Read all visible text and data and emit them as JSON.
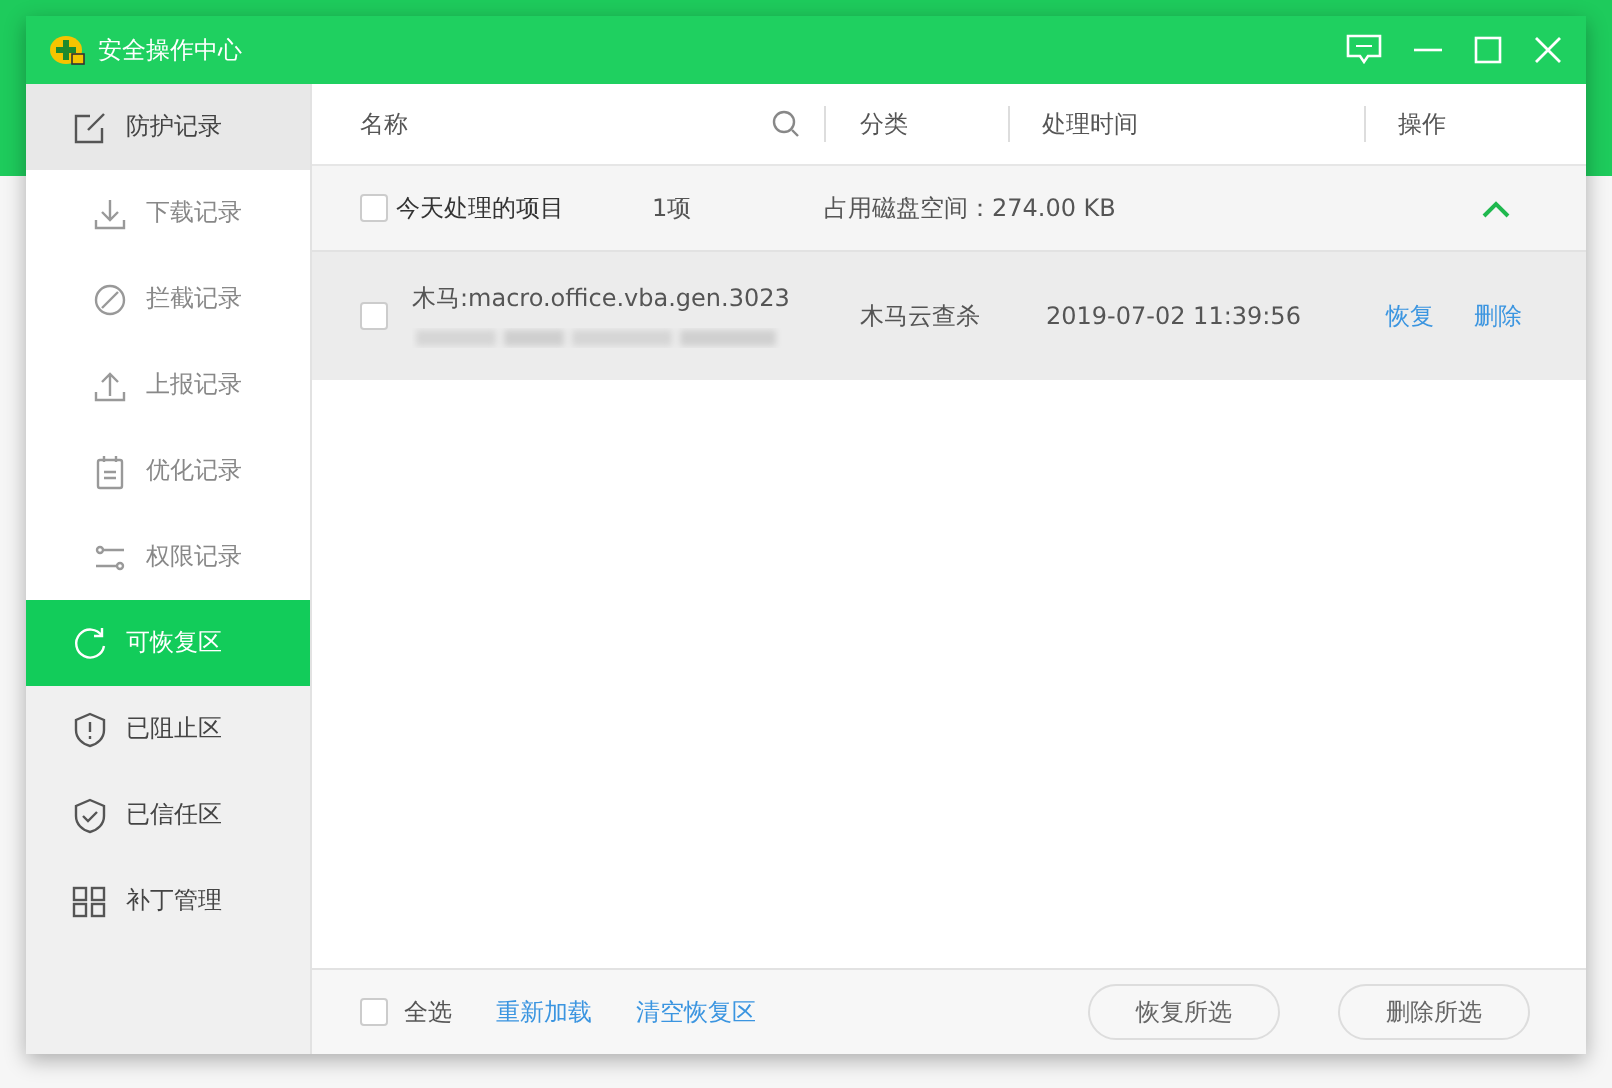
{
  "window": {
    "title": "安全操作中心"
  },
  "sidebar": {
    "items": [
      {
        "label": "防护记录",
        "selected": false,
        "expanded": true,
        "children": [
          {
            "label": "下载记录",
            "selected": false
          },
          {
            "label": "拦截记录",
            "selected": false
          },
          {
            "label": "上报记录",
            "selected": false
          },
          {
            "label": "优化记录",
            "selected": false
          },
          {
            "label": "权限记录",
            "selected": false
          }
        ]
      },
      {
        "label": "可恢复区",
        "selected": true
      },
      {
        "label": "已阻止区",
        "selected": false
      },
      {
        "label": "已信任区",
        "selected": false
      },
      {
        "label": "补丁管理",
        "selected": false
      }
    ]
  },
  "table": {
    "columns": [
      "名称",
      "分类",
      "处理时间",
      "操作"
    ],
    "groups": [
      {
        "title": "今天处理的项目",
        "count": "1项",
        "size": "占用磁盘空间：274.00 KB",
        "checked": false,
        "expanded": true,
        "rows": [
          {
            "name": "木马:macro.office.vba.gen.3023",
            "category": "木马云查杀",
            "time": "2019-07-02 11:39:56",
            "checked": false,
            "actions": [
              "恢复",
              "删除"
            ]
          }
        ]
      }
    ]
  },
  "footer": {
    "select_all": {
      "label": "全选",
      "checked": false
    },
    "links": [
      "重新加载",
      "清空恢复区"
    ],
    "buttons": [
      "恢复所选",
      "删除所选"
    ]
  }
}
